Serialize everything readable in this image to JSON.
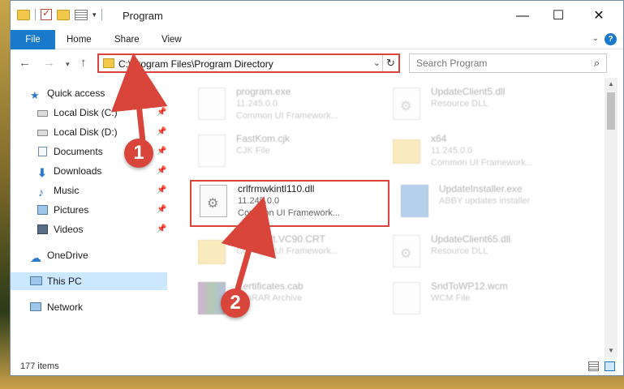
{
  "window": {
    "title": "Program",
    "min_glyph": "—",
    "max_glyph": "☐",
    "close_glyph": "✕"
  },
  "ribbon": {
    "tabs": [
      "File",
      "Home",
      "Share",
      "View"
    ]
  },
  "nav": {
    "address": "C:\\Program Files\\Program Directory",
    "search_placeholder": "Search Program"
  },
  "sidebar": {
    "items": [
      {
        "label": "Quick access",
        "icon": "star-icon",
        "pinned": false
      },
      {
        "label": "Local Disk (C:)",
        "icon": "drive-icon",
        "pinned": true
      },
      {
        "label": "Local Disk (D:)",
        "icon": "drive-icon",
        "pinned": true
      },
      {
        "label": "Documents",
        "icon": "documents-icon",
        "pinned": true
      },
      {
        "label": "Downloads",
        "icon": "download-icon",
        "pinned": true
      },
      {
        "label": "Music",
        "icon": "music-icon",
        "pinned": true
      },
      {
        "label": "Pictures",
        "icon": "pictures-icon",
        "pinned": true
      },
      {
        "label": "Videos",
        "icon": "videos-icon",
        "pinned": true
      },
      {
        "label": "OneDrive",
        "icon": "cloud-icon",
        "pinned": false
      },
      {
        "label": "This PC",
        "icon": "computer-icon",
        "pinned": false
      },
      {
        "label": "Network",
        "icon": "network-icon",
        "pinned": false
      }
    ]
  },
  "files": [
    {
      "name": "program.exe",
      "line2": "11.245.0.0",
      "line3": "Common UI Framework...",
      "kind": "exe"
    },
    {
      "name": "UpdateClient5.dll",
      "line2": "Resource DLL",
      "line3": "",
      "kind": "dll"
    },
    {
      "name": "FastKom.cjk",
      "line2": "CJK File",
      "line3": "",
      "kind": "doc"
    },
    {
      "name": "x64",
      "line2": "11.245.0.0",
      "line3": "Common UI Framework...",
      "kind": "folder"
    },
    {
      "name": "crlfrmwkintl110.dll",
      "line2": "11.245.0.0",
      "line3": "Common UI Framework...",
      "kind": "dll"
    },
    {
      "name": "UpdateInstaller.exe",
      "line2": "ABBY updates installer",
      "line3": "",
      "kind": "exe"
    },
    {
      "name": "Microsoft.VC90.CRT",
      "line2": "Common UI Framework...",
      "line3": "",
      "kind": "folder"
    },
    {
      "name": "UpdateClient65.dll",
      "line2": "Resource DLL",
      "line3": "",
      "kind": "dll"
    },
    {
      "name": "Certificates.cab",
      "line2": "WinRAR Archive",
      "line3": "",
      "kind": "archive"
    },
    {
      "name": "SndToWP12.wcm",
      "line2": "WCM File",
      "line3": "",
      "kind": "doc"
    }
  ],
  "status": {
    "item_count": "177 items"
  },
  "callouts": [
    "1",
    "2"
  ],
  "colors": {
    "accent": "#1979ca",
    "highlight": "#d9453a",
    "selected": "#cce8ff"
  }
}
